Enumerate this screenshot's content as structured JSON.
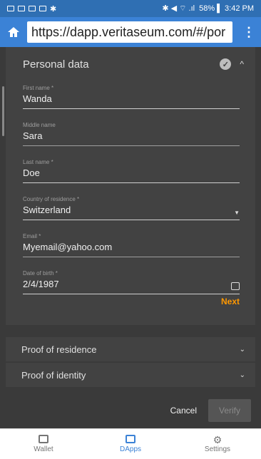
{
  "statusbar": {
    "time_battery": "58% ▌ 3:42 PM"
  },
  "urlbar": {
    "url": "https://dapp.veritaseum.com/#/por"
  },
  "personal": {
    "title": "Personal data",
    "fields": [
      {
        "label": "First name *",
        "value": "Wanda"
      },
      {
        "label": "Middle name",
        "value": "Sara"
      },
      {
        "label": "Last name *",
        "value": "Doe"
      },
      {
        "label": "Country of residence *",
        "value": "Switzerland"
      },
      {
        "label": "Email *",
        "value": "Myemail@yahoo.com"
      },
      {
        "label": "Date of birth *",
        "value": "2/4/1987"
      }
    ],
    "next": "Next"
  },
  "sections": {
    "residence": "Proof of residence",
    "identity": "Proof of identity"
  },
  "actions": {
    "cancel": "Cancel",
    "verify": "Verify"
  },
  "nav": {
    "wallet": "Wallet",
    "dapps": "DApps",
    "settings": "Settings"
  },
  "colors": {
    "accent": "#3b82d6",
    "next": "#ff9800",
    "panel": "#424242"
  }
}
